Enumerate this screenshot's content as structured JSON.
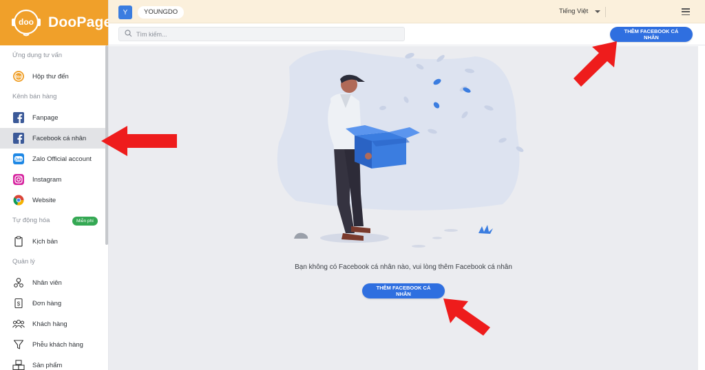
{
  "app": {
    "name": "DooPage",
    "logo_text": "DooPage"
  },
  "topbar": {
    "avatar_initial": "Y",
    "org_name": "YOUNGDO",
    "language": "Tiếng Việt"
  },
  "search": {
    "placeholder": "Tìm kiếm..."
  },
  "sidebar": {
    "sections": [
      {
        "label": "Ứng dụng tư vấn",
        "items": [
          {
            "label": "Hộp thư đến",
            "icon": "inbox-icon"
          }
        ]
      },
      {
        "label": "Kênh bán hàng",
        "items": [
          {
            "label": "Fanpage",
            "icon": "facebook-icon"
          },
          {
            "label": "Facebook cá nhân",
            "icon": "facebook-icon",
            "active": true
          },
          {
            "label": "Zalo Official account",
            "icon": "zalo-icon"
          },
          {
            "label": "Instagram",
            "icon": "instagram-icon"
          },
          {
            "label": "Website",
            "icon": "chrome-icon"
          }
        ]
      },
      {
        "label": "Tự động hóa",
        "badge": "Miễn phí",
        "items": [
          {
            "label": "Kịch bản",
            "icon": "clipboard-icon"
          }
        ]
      },
      {
        "label": "Quản lý",
        "items": [
          {
            "label": "Nhân viên",
            "icon": "staff-icon"
          },
          {
            "label": "Đơn hàng",
            "icon": "order-icon"
          },
          {
            "label": "Khách hàng",
            "icon": "customers-icon"
          },
          {
            "label": "Phễu khách hàng",
            "icon": "funnel-icon"
          },
          {
            "label": "Sản phẩm",
            "icon": "products-icon"
          }
        ]
      }
    ]
  },
  "main": {
    "add_button_label": "THÊM FACEBOOK CÁ NHÂN",
    "empty_message": "Bạn không có Facebook cá nhân nào, vui lòng thêm Facebook cá nhân",
    "empty_button_label": "THÊM FACEBOOK CÁ NHÂN"
  },
  "colors": {
    "brand_orange": "#f0a02a",
    "primary_blue": "#2f6fe0",
    "annotation_red": "#ee1c1c",
    "free_badge_green": "#34a853"
  }
}
